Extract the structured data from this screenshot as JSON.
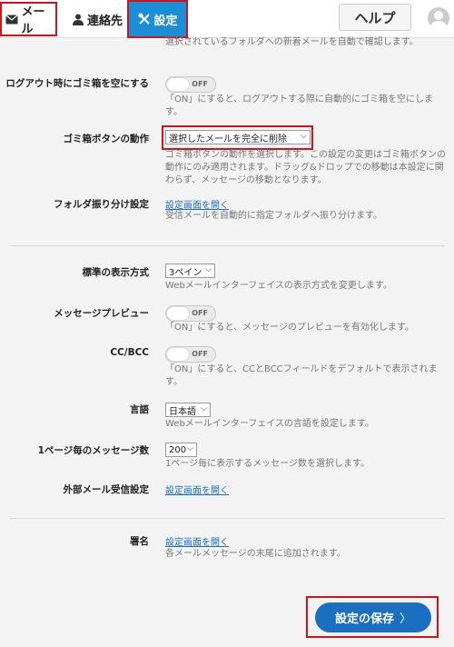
{
  "header": {
    "tabs": [
      {
        "label": "メール"
      },
      {
        "label": "連絡先"
      },
      {
        "label": "設定"
      }
    ],
    "help_label": "ヘルプ"
  },
  "top_desc": "選択されているフォルダへの新着メールを自動で確認します。",
  "settings": {
    "logout_trash": {
      "label": "ログアウト時にゴミ箱を空にする",
      "toggle": "OFF",
      "desc": "「ON」にすると、ログアウトする際に自動的にゴミ箱を空にします。"
    },
    "trash_button": {
      "label": "ゴミ箱ボタンの動作",
      "value": "選択したメールを完全に削除",
      "desc": "ゴミ箱ボタンの動作を選択します。この設定の変更はゴミ箱ボタンの動作にのみ適用されます。ドラッグ&ドロップでの移動は本設定に関わらず、メッセージの移動となります。"
    },
    "folder_sort": {
      "label": "フォルダ振り分け設定",
      "link": "設定画面を開く",
      "desc": "受信メールを自動的に指定フォルダへ振り分けます。"
    },
    "display_mode": {
      "label": "標準の表示方式",
      "value": "3ペイン",
      "desc": "Webメールインターフェイスの表示方式を変更します。"
    },
    "preview": {
      "label": "メッセージプレビュー",
      "toggle": "OFF",
      "desc": "「ON」にすると、メッセージのプレビューを有効化します。"
    },
    "ccbcc": {
      "label": "CC/BCC",
      "toggle": "OFF",
      "desc": "「ON」にすると、CCとBCCフィールドをデフォルトで表示されます。"
    },
    "language": {
      "label": "言語",
      "value": "日本語",
      "desc": "Webメールインターフェイスの言語を設定します。"
    },
    "per_page": {
      "label": "1ページ毎のメッセージ数",
      "value": "200",
      "desc": "1ページ毎に表示するメッセージ数を選択します。"
    },
    "external_mail": {
      "label": "外部メール受信設定",
      "link": "設定画面を開く"
    },
    "signature": {
      "label": "署名",
      "link": "設定画面を開く",
      "desc": "各メールメッセージの末尾に追加されます。"
    }
  },
  "save_label": "設定の保存",
  "colors": {
    "accent": "#1a8fd6",
    "button": "#1a6fc0",
    "highlight": "#d0141b"
  }
}
